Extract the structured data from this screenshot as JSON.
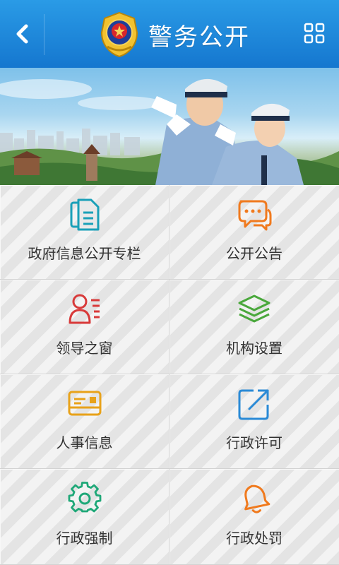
{
  "header": {
    "title": "警务公开",
    "back_icon": "chevron-left-icon",
    "menu_icon": "grid-menu-icon",
    "emblem": "police-emblem"
  },
  "colors": {
    "header": "#1a86d8",
    "teal": "#1aa0b8",
    "orange": "#f07a1e",
    "red": "#d83a3a",
    "green": "#4aa83c",
    "yellow": "#e8a21a",
    "blue": "#2a8ad6"
  },
  "grid": [
    {
      "label": "政府信息公开专栏",
      "icon": "documents-icon",
      "color": "#1aa0b8"
    },
    {
      "label": "公开公告",
      "icon": "chat-bubbles-icon",
      "color": "#f07a1e"
    },
    {
      "label": "领导之窗",
      "icon": "leader-list-icon",
      "color": "#d83a3a"
    },
    {
      "label": "机构设置",
      "icon": "layers-icon",
      "color": "#4aa83c"
    },
    {
      "label": "人事信息",
      "icon": "id-card-icon",
      "color": "#e8a21a"
    },
    {
      "label": "行政许可",
      "icon": "external-link-icon",
      "color": "#2a8ad6"
    },
    {
      "label": "行政强制",
      "icon": "gear-icon",
      "color": "#1fa878"
    },
    {
      "label": "行政处罚",
      "icon": "bell-icon",
      "color": "#f07a1e"
    }
  ]
}
